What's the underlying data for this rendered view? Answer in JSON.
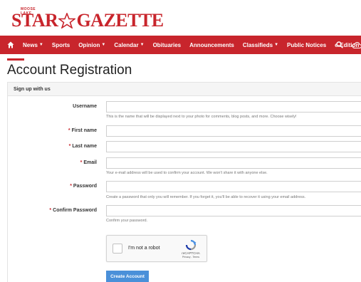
{
  "logo": {
    "small_text": "MOOSE LAKE",
    "word1": "STAR",
    "word2": "GAZETTE"
  },
  "nav": {
    "items": [
      {
        "label": "News",
        "dropdown": true
      },
      {
        "label": "Sports",
        "dropdown": false
      },
      {
        "label": "Opinion",
        "dropdown": true
      },
      {
        "label": "Calendar",
        "dropdown": true
      },
      {
        "label": "Obituaries",
        "dropdown": false
      },
      {
        "label": "Announcements",
        "dropdown": false
      },
      {
        "label": "Classifieds",
        "dropdown": true
      },
      {
        "label": "Public Notices",
        "dropdown": false
      },
      {
        "label": "e-Edition",
        "dropdown": false
      }
    ],
    "icons": [
      "home-icon",
      "search-icon",
      "weather-icon"
    ]
  },
  "page": {
    "title": "Account Registration"
  },
  "panel": {
    "heading": "Sign up with us"
  },
  "form": {
    "username_label": "Username",
    "username_help": "This is the name that will be displayed next to your photo for comments, blog posts, and more. Choose wisely!",
    "first_name_label": "First name",
    "last_name_label": "Last name",
    "email_label": "Email",
    "email_help": "Your e-mail address will be used to confirm your account. We won't share it with anyone else.",
    "password_label": "Password",
    "password_help": "Create a password that only you will remember. If you forget it, you'll be able to recover it using your email address.",
    "confirm_label": "Confirm Password",
    "confirm_help": "Confirm your password.",
    "required_mark": "*"
  },
  "captcha": {
    "label": "I'm not a robot",
    "brand": "reCAPTCHA",
    "links": "Privacy - Terms"
  },
  "submit": {
    "label": "Create Account"
  },
  "colors": {
    "brand_red": "#c8252c",
    "button_blue": "#4a90d9"
  }
}
